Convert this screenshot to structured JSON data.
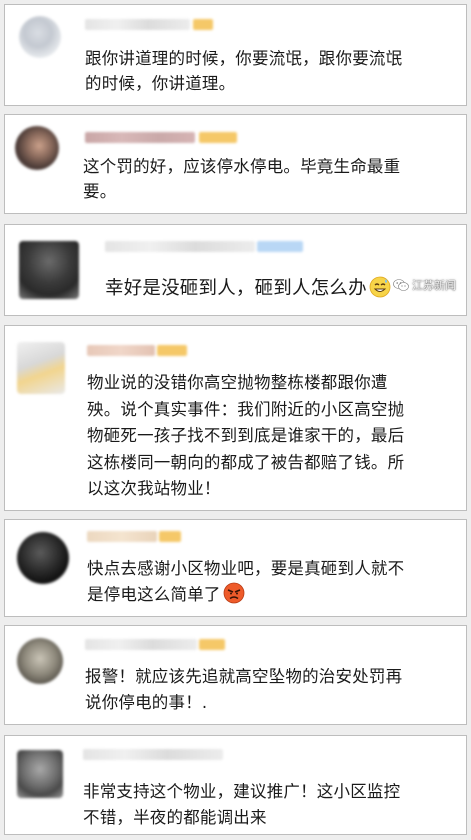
{
  "comments": [
    {
      "lines": [
        "跟你讲道理的时候，你要流氓，跟你要流氓",
        "的时候，你讲道理。"
      ]
    },
    {
      "lines": [
        "这个罚的好，应该停水停电。毕竟生命最重",
        "要。"
      ]
    },
    {
      "lines": [
        "幸好是没砸到人，砸到人怎么办"
      ],
      "emoji": "smile-sweat-emoji"
    },
    {
      "lines": [
        "物业说的没错你高空抛物整栋楼都跟你遭",
        "殃。说个真实事件：我们附近的小区高空抛",
        "物砸死一孩子找不到到底是谁家干的，最后",
        "这栋楼同一朝向的都成了被告都赔了钱。所",
        "以这次我站物业！"
      ]
    },
    {
      "lines": [
        "快点去感谢小区物业吧，要是真砸到人就不",
        "是停电这么简单了"
      ],
      "emoji": "angry-face-emoji"
    },
    {
      "lines": [
        "报警！就应该先追就高空坠物的治安处罚再",
        "说你停电的事！."
      ]
    },
    {
      "lines": [
        "非常支持这个物业，建议推广！这小区监控",
        "不错，半夜的都能调出来"
      ]
    }
  ],
  "watermark": {
    "text": "江苏新闻",
    "icon": "wechat-icon"
  },
  "colors": {
    "background": "#eeeeee",
    "card": "#ffffff",
    "border": "#bdbdbd",
    "text": "#1a1a1a",
    "badge": "#f5c868"
  }
}
